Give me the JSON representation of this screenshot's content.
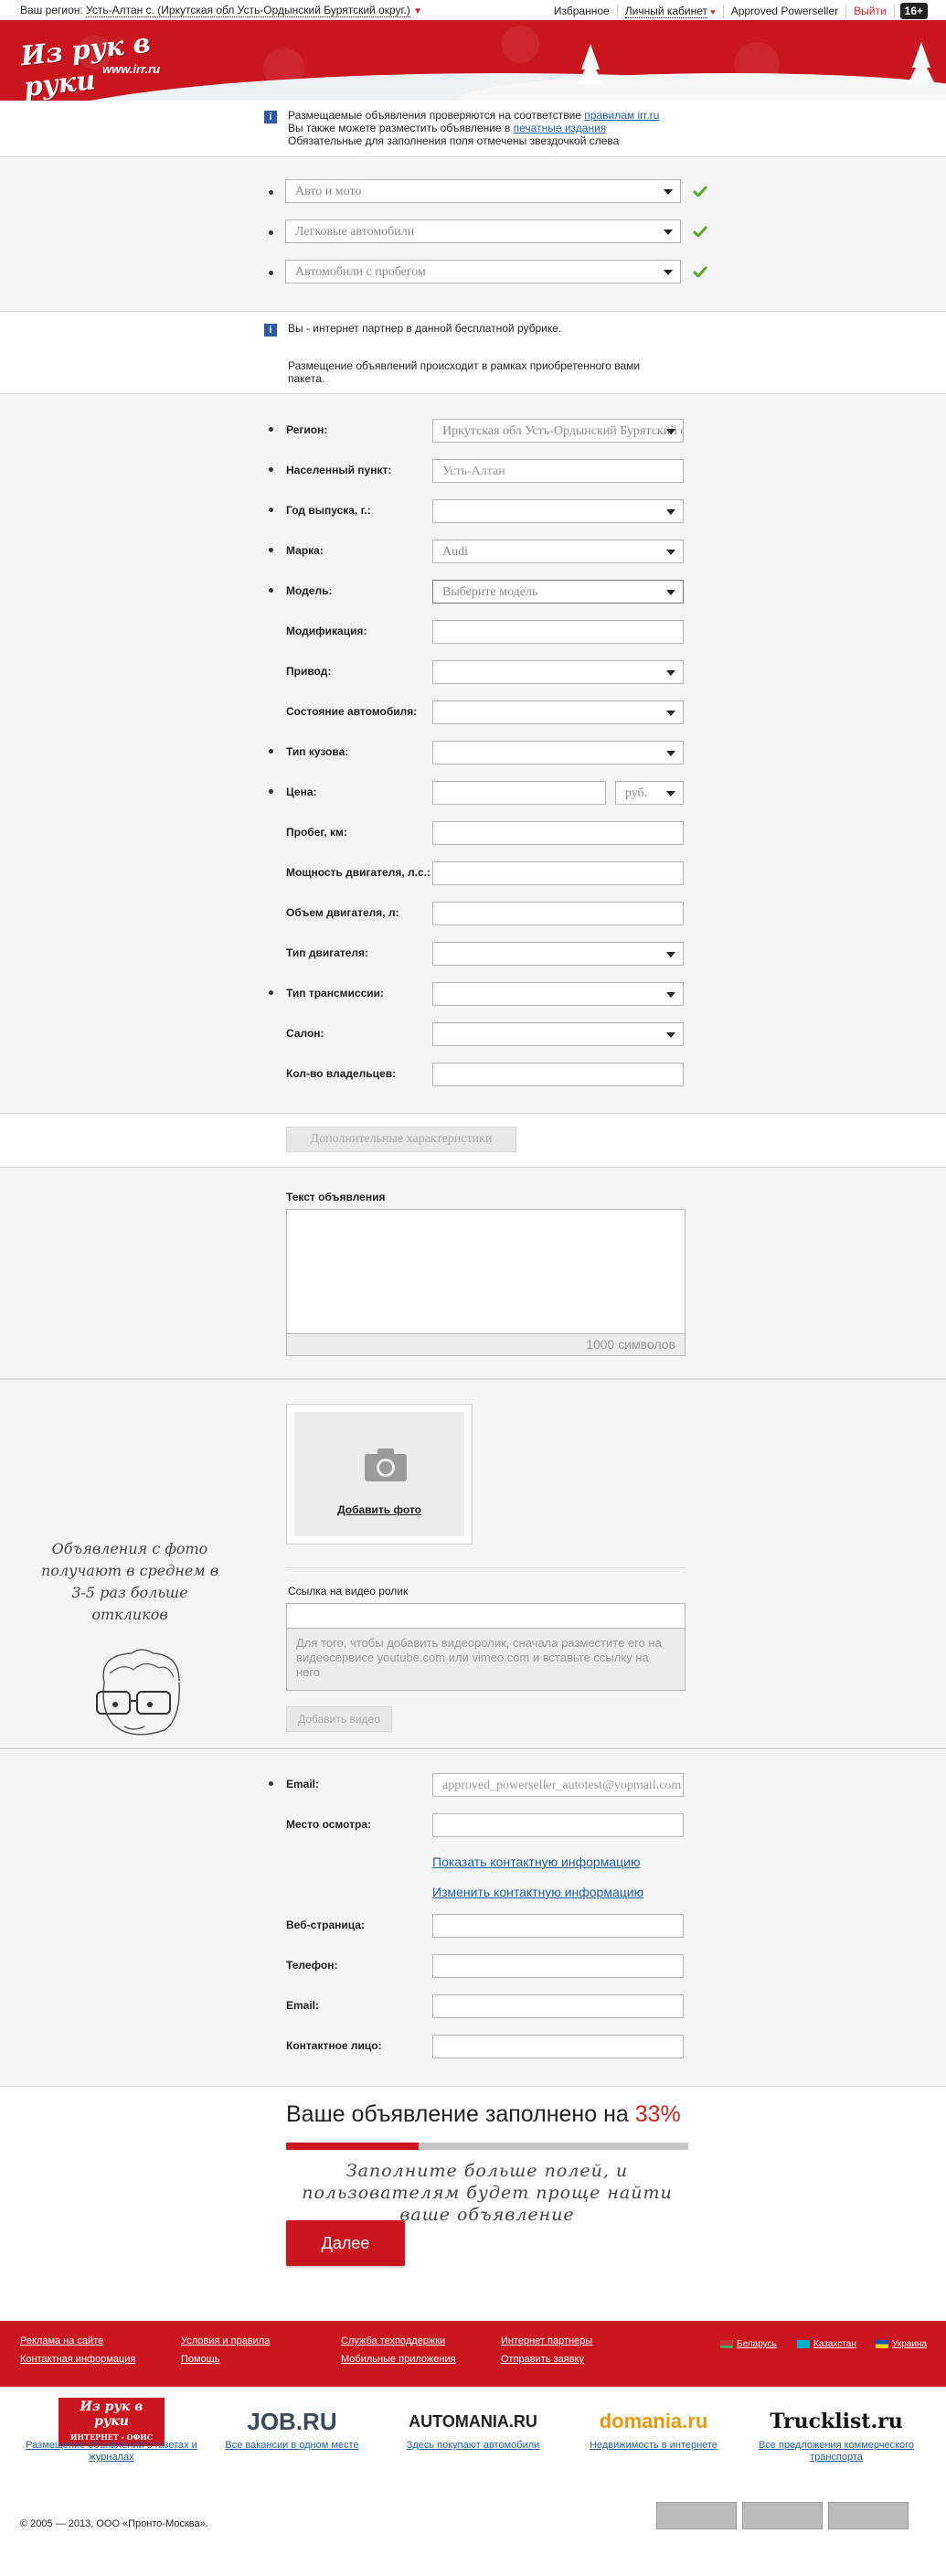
{
  "topbar": {
    "region_prefix": "Ваш регион:",
    "region_value": "Усть-Алтан с. (Иркутская обл Усть-Ордынский Бурятский округ.)",
    "favorites": "Избранное",
    "cabinet": "Личный кабинет",
    "user": "Approved Powerseller",
    "logout": "Выйти",
    "age_badge": "16+"
  },
  "header": {
    "logo_text": "Из рук в руки",
    "logo_url": "www.irr.ru"
  },
  "info_top": {
    "line1_prefix": "Размещаемые объявления проверяются на соответствие ",
    "line1_link": "правилам irr.ru",
    "line2_prefix": "Вы также можете разместить объявление в ",
    "line2_link": "печатные издания",
    "line3": "Обязательные для заполнения поля отмечены звездочкой слева"
  },
  "categories": [
    {
      "value": "Авто и мото"
    },
    {
      "value": "Легковые автомобили"
    },
    {
      "value": "Автомобили с пробегом"
    }
  ],
  "info_partner": {
    "line1": "Вы - интернет партнер в данной бесплатной рубрике.",
    "line2": "Размещение объявлений происходит в рамках приобретенного вами пакета."
  },
  "form": {
    "region_label": "Регион:",
    "region_value": "Иркутская обл Усть-Ордынский Бурятский округ",
    "city_label": "Населенный пункт:",
    "city_value": "Усть-Алтан",
    "year_label": "Год выпуска, г.:",
    "brand_label": "Марка:",
    "brand_value": "Audi",
    "model_label": "Модель:",
    "model_value": "Выберите модель",
    "modification_label": "Модификация:",
    "drive_label": "Привод:",
    "condition_label": "Состояние автомобиля:",
    "body_label": "Тип кузова:",
    "price_label": "Цена:",
    "currency_value": "руб.",
    "mileage_label": "Пробег, км:",
    "power_label": "Мощность двигателя, л.с.:",
    "volume_label": "Объем двигателя, л:",
    "engine_label": "Тип двигателя:",
    "transmission_label": "Тип трансмиссии:",
    "salon_label": "Салон:",
    "owners_label": "Кол-во владельцев:",
    "extra_button": "Дополнительные характеристики"
  },
  "text_section": {
    "label": "Текст объявления",
    "counter": "1000 символов"
  },
  "photo_section": {
    "add_photo": "Добавить фото",
    "handwritten": "Объявления с фото получают в среднем в 3-5 раз больше откликов",
    "video_label": "Ссылка на видео ролик",
    "video_hint": "Для того, чтобы добавить видеоролик, сначала разместите его на видеосервисе youtube.com или vimeo.com и вставьте ссылку на него",
    "add_video": "Добавить видео"
  },
  "contacts": {
    "email_label": "Email:",
    "email_value": "approved_powerseller_autotest@yopmail.com",
    "place_label": "Место осмотра:",
    "show_contacts": "Показать контактную информацию",
    "edit_contacts": "Изменить контактную информацию",
    "web_label": "Веб-страница:",
    "phone_label": "Телефон:",
    "email2_label": "Email:",
    "person_label": "Контактное лицо:"
  },
  "completion": {
    "title_prefix": "Ваше объявление заполнено на ",
    "percent_text": "33%",
    "percent": 0.33,
    "hint": "Заполните больше полей, и пользователям будет проще найти ваше объявление",
    "next_button": "Далее"
  },
  "footer": {
    "links": {
      "ads": "Реклама на сайте",
      "contacts": "Контактная информация",
      "terms": "Условия и правила",
      "help": "Помощь",
      "support": "Служба техподдержки",
      "mobile": "Мобильные приложения",
      "partners": "Интернет партнеры",
      "request": "Отправить заявку"
    },
    "countries": [
      "Беларусь",
      "Казахстан",
      "Украина"
    ],
    "partners": [
      {
        "logo": "Из рук в руки",
        "logo_sub": "ИНТЕРНЕТ - ОФИС",
        "caption": "Размещение объявлений в газетах и журналах"
      },
      {
        "logo": "JOB.RU",
        "caption": "Все вакансии в одном месте"
      },
      {
        "logo": "AUTOMANIA.RU",
        "caption": "Здесь покупают автомобили"
      },
      {
        "logo": "domania.ru",
        "caption": "Недвижимость в интернете"
      },
      {
        "logo": "Trucklist.ru",
        "caption": "Все предложения коммерческого транспорта"
      }
    ],
    "copyright": "© 2005 — 2013, ООО «Пронто-Москва»."
  },
  "colors": {
    "brand_red": "#c9161f",
    "link_blue": "#1b5fa8",
    "check_green": "#57a82f"
  }
}
